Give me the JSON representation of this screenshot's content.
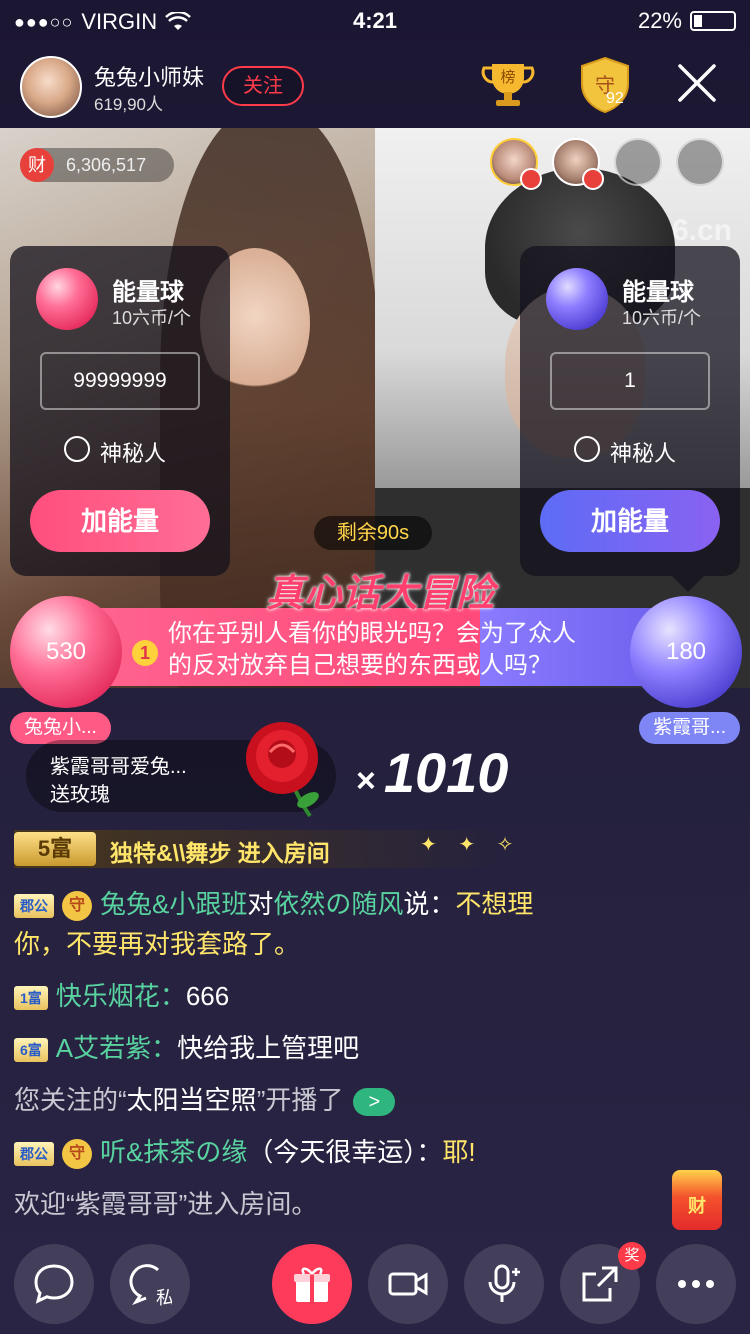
{
  "status_bar": {
    "carrier": "VIRGIN",
    "time": "4:21",
    "battery": "22%"
  },
  "host": {
    "name": "兔兔小师妹",
    "followers": "619,90人",
    "follow_label": "关注",
    "rank_label": "榜",
    "guard_label": "守",
    "guard_count": "92"
  },
  "room": {
    "wealth_icon": "财",
    "wealth_value": "6,306,517",
    "watermark": "6.cn",
    "remaining": "剩余90s"
  },
  "left_panel": {
    "title": "能量球",
    "price": "10六币/个",
    "input_value": "99999999",
    "anon_label": "神秘人",
    "add_label": "加能量"
  },
  "right_panel": {
    "title": "能量球",
    "price": "10六币/个",
    "input_value": "1",
    "anon_label": "神秘人",
    "add_label": "加能量"
  },
  "truth_or_dare": {
    "title": "真心话大冒险",
    "question_number": "1",
    "question_line1": "你在乎别人看你的眼光吗？会为了众人",
    "question_line2": "的反对放弃自己想要的东西或人吗？",
    "left_score": "530",
    "right_score": "180",
    "left_name": "兔兔小...",
    "right_name": "紫霞哥..."
  },
  "gift": {
    "sender": "紫霞哥哥爱兔...",
    "action": "送玫瑰",
    "x": "×",
    "count": "1010"
  },
  "entry": {
    "level": "5富",
    "text": "独特&\\\\舞步  进入房间"
  },
  "chat": [
    {
      "badge": "郡公",
      "shield": "守",
      "user": "兔兔&小跟班",
      "mid": "对",
      "target": "依然の随风",
      "say": "说：",
      "text": "不想理",
      "text2": "你，不要再对我套路了。"
    },
    {
      "badge": "1富",
      "user": "快乐烟花",
      "colon": "：",
      "text": "666"
    },
    {
      "badge": "6富",
      "user": "A艾若紫",
      "colon": "：",
      "text": "快给我上管理吧"
    },
    {
      "pre": "您关注的“",
      "name": "太阳当空照",
      "post": "”开播了",
      "go": ">"
    },
    {
      "badge": "郡公",
      "shield": "守",
      "user": "听&抹茶の缘",
      "text": "（今天很幸运）：",
      "tail": "耶!"
    },
    {
      "text": "欢迎“紫霞哥哥”进入房间。"
    }
  ],
  "redpack_label": "财",
  "bottom": {
    "private_label": "私",
    "prize_badge": "奖"
  },
  "colors": {
    "accent_pink": "#ff4e7e",
    "accent_blue": "#6a5dea",
    "follow_red": "#ff3b4a",
    "chat_green": "#58d39f",
    "chat_yellow": "#ffe56a"
  }
}
